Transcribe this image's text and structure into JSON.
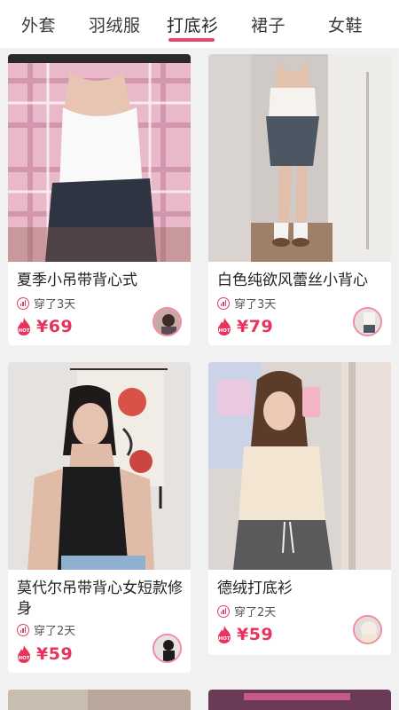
{
  "tabs": [
    "外套",
    "羽绒服",
    "打底衫",
    "裙子",
    "女鞋"
  ],
  "active_tab_index": 2,
  "colors": {
    "accent": "#e8466c",
    "price": "#e8335f"
  },
  "cards": [
    {
      "title": "夏季小吊带背心式",
      "worn": "穿了3天",
      "price": "¥69",
      "badge": "HOT"
    },
    {
      "title": "白色纯欲风蕾丝小背心",
      "worn": "穿了3天",
      "price": "¥79",
      "badge": "HOT"
    },
    {
      "title": "莫代尔吊带背心女短款修身",
      "worn": "穿了2天",
      "price": "¥59",
      "badge": "HOT"
    },
    {
      "title": "德绒打底衫",
      "worn": "穿了2天",
      "price": "¥59",
      "badge": "HOT"
    }
  ]
}
